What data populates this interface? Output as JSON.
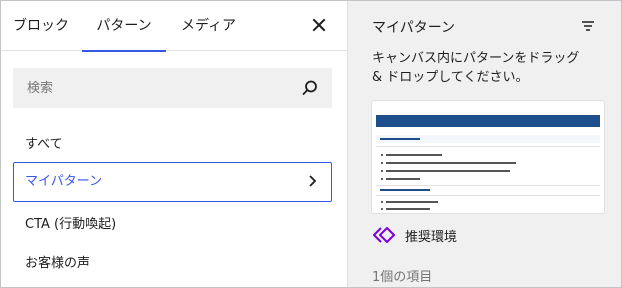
{
  "tabs": {
    "blocks": "ブロック",
    "patterns": "パターン",
    "media": "メディア"
  },
  "search": {
    "placeholder": "検索"
  },
  "categories": [
    {
      "label": "すべて"
    },
    {
      "label": "マイパターン"
    },
    {
      "label": "CTA (行動喚起)"
    },
    {
      "label": "お客様の声"
    }
  ],
  "panel": {
    "title": "マイパターン",
    "description": "キャンバス内にパターンをドラッグ & ドロップしてください。",
    "pattern_name": "推奨環境",
    "count": "1個の項目"
  },
  "icons": {
    "close": "close-icon",
    "search": "search-icon",
    "chevron": "chevron-right-icon",
    "filter": "filter-icon",
    "pattern": "synced-pattern-icon"
  },
  "colors": {
    "accent": "#3858e9",
    "pattern_icon": "#7a00df"
  }
}
